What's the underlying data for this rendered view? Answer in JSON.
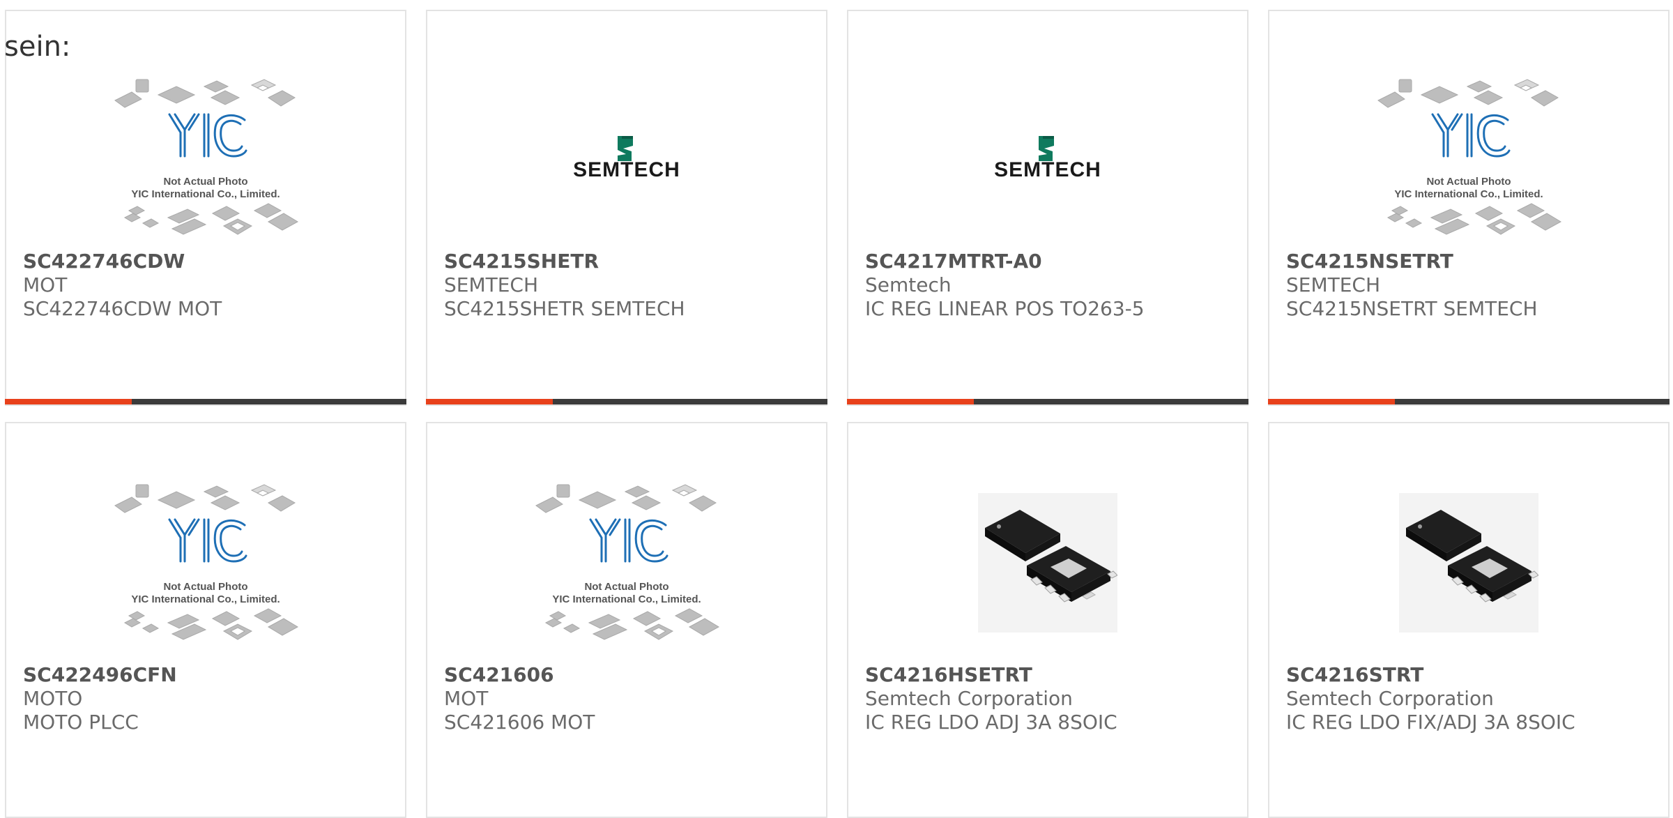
{
  "intro_text": "sein:",
  "placeholder": {
    "logo_text": "YIC",
    "caption_line1": "Not Actual Photo",
    "caption_line2": "YIC International Co., Limited."
  },
  "brand_logo": {
    "text": "SEMTECH",
    "color": "#1a1a1a",
    "mark_color": "#0f7a5e"
  },
  "colors": {
    "accent_bar": "#e8411b",
    "dark_bar": "#3b3b3b",
    "border": "#e3e3e3",
    "yic_blue": "#1e6fb5"
  },
  "products": [
    {
      "part": "SC422746CDW",
      "manufacturer": "MOT",
      "description": "SC422746CDW MOT",
      "image": "not-actual-photo"
    },
    {
      "part": "SC4215SHETR",
      "manufacturer": "SEMTECH",
      "description": "SC4215SHETR SEMTECH",
      "image": "semtech-logo"
    },
    {
      "part": "SC4217MTRT-A0",
      "manufacturer": "Semtech",
      "description": "IC REG LINEAR POS TO263-5",
      "image": "semtech-logo"
    },
    {
      "part": "SC4215NSETRT",
      "manufacturer": "SEMTECH",
      "description": "SC4215NSETRT SEMTECH",
      "image": "not-actual-photo"
    },
    {
      "part": "SC422496CFN",
      "manufacturer": "MOTO",
      "description": "MOTO PLCC",
      "image": "not-actual-photo"
    },
    {
      "part": "SC421606",
      "manufacturer": "MOT",
      "description": "SC421606 MOT",
      "image": "not-actual-photo"
    },
    {
      "part": "SC4216HSETRT",
      "manufacturer": "Semtech Corporation",
      "description": "IC REG LDO ADJ 3A 8SOIC",
      "image": "soic-8-chip"
    },
    {
      "part": "SC4216STRT",
      "manufacturer": "Semtech Corporation",
      "description": "IC REG LDO FIX/ADJ 3A 8SOIC",
      "image": "soic-8-chip"
    }
  ]
}
